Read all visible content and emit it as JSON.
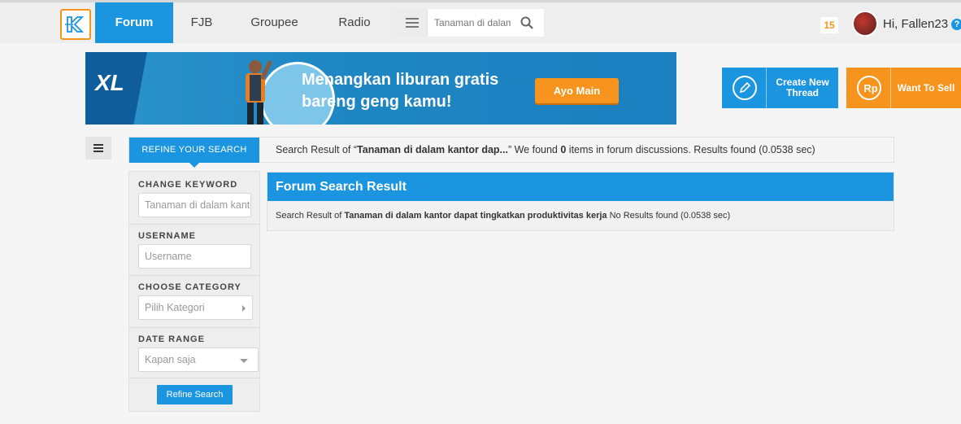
{
  "nav": {
    "tabs": [
      {
        "label": "Forum",
        "active": true
      },
      {
        "label": "FJB"
      },
      {
        "label": "Groupee"
      },
      {
        "label": "Radio"
      }
    ],
    "search_value": "Tanaman di dalam kantor dapat tingkatkan produktivitas kerja",
    "notifications": "15",
    "greeting": "Hi, Fallen23",
    "help": "?"
  },
  "banner": {
    "brand": "XL",
    "line1": "Menangkan liburan gratis",
    "line2": "bareng geng kamu!",
    "cta": "Ayo Main"
  },
  "actions": {
    "create_line1": "Create New",
    "create_line2": "Thread",
    "sell": "Want To Sell",
    "sell_icon_text": "Rp"
  },
  "refine": {
    "tab_label": "REFINE YOUR SEARCH",
    "result_prefix": "Search Result of “",
    "result_query": "Tanaman di dalam kantor dap...",
    "result_mid": "” We found ",
    "result_count": "0",
    "result_suffix": " items in forum discussions. Results found (0.0538 sec)"
  },
  "filters": {
    "keyword_label": "CHANGE KEYWORD",
    "keyword_value": "Tanaman di dalam kantor dapat tingkatkan produktivitas kerja",
    "username_label": "USERNAME",
    "username_placeholder": "Username",
    "category_label": "CHOOSE CATEGORY",
    "category_value": "Pilih Kategori",
    "date_label": "DATE RANGE",
    "date_value": "Kapan saja",
    "submit": "Refine Search"
  },
  "results": {
    "title": "Forum Search Result",
    "detail_prefix": "Search Result of ",
    "detail_query": "Tanaman di dalam kantor dapat tingkatkan produktivitas kerja",
    "detail_suffix": " No Results found (0.0538 sec)"
  },
  "colors": {
    "primary": "#1b95e0",
    "accent": "#f7941d"
  }
}
